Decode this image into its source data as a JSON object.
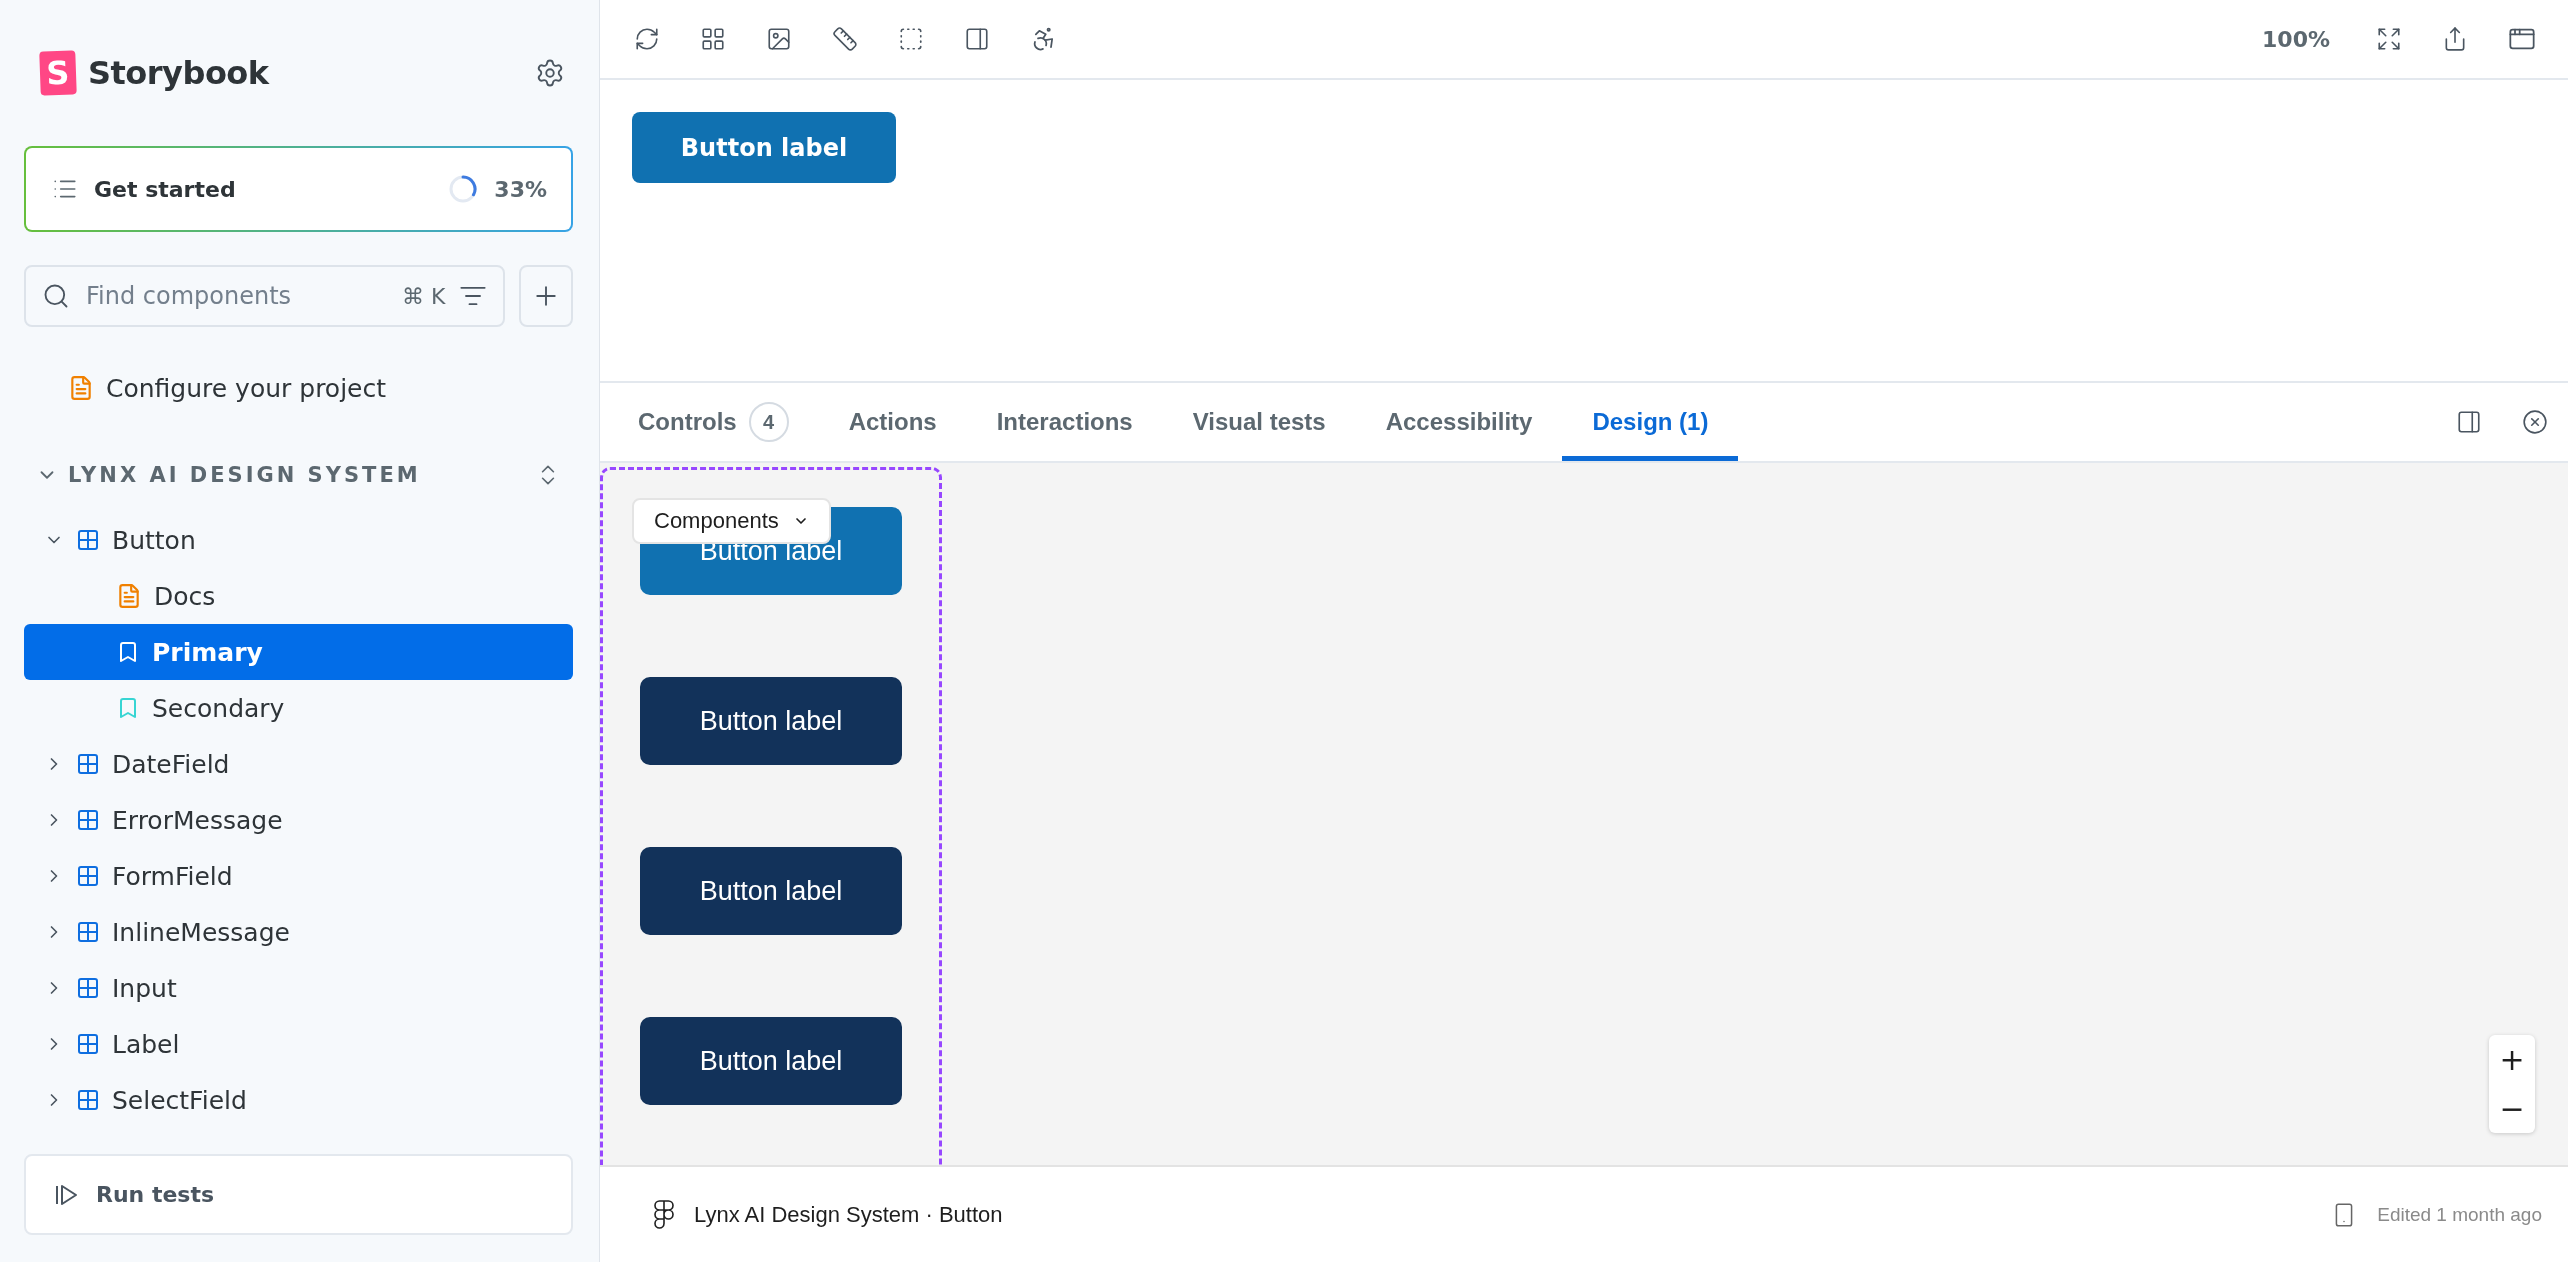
{
  "sidebar": {
    "brand": {
      "letter": "S",
      "name": "Storybook"
    },
    "onboarding": {
      "label": "Get started",
      "progress": "33%",
      "level": 0.33
    },
    "search": {
      "placeholder": "Find components",
      "shortcut": "⌘ K"
    },
    "pinned": [
      {
        "label": "Configure your project",
        "kind": "doc",
        "selected": false
      }
    ],
    "section": {
      "title": "LYNX AI DESIGN SYSTEM",
      "expanded": true
    },
    "tree": [
      {
        "label": "Button",
        "kind": "component",
        "expanded": true,
        "selected": false,
        "children": [
          {
            "label": "Docs",
            "kind": "doc",
            "selected": false
          },
          {
            "label": "Primary",
            "kind": "story",
            "selected": true
          },
          {
            "label": "Secondary",
            "kind": "story",
            "selected": false
          }
        ]
      },
      {
        "label": "DateField",
        "kind": "component",
        "expanded": false,
        "selected": false
      },
      {
        "label": "ErrorMessage",
        "kind": "component",
        "expanded": false,
        "selected": false
      },
      {
        "label": "FormField",
        "kind": "component",
        "expanded": false,
        "selected": false
      },
      {
        "label": "InlineMessage",
        "kind": "component",
        "expanded": false,
        "selected": false
      },
      {
        "label": "Input",
        "kind": "component",
        "expanded": false,
        "selected": false
      },
      {
        "label": "Label",
        "kind": "component",
        "expanded": false,
        "selected": false
      },
      {
        "label": "SelectField",
        "kind": "component",
        "expanded": false,
        "selected": false
      }
    ],
    "run_tests": "Run tests"
  },
  "toolbar": {
    "zoom": "100%"
  },
  "preview": {
    "button": "Button label"
  },
  "addons": {
    "tabs": [
      {
        "label": "Controls",
        "badge": "4",
        "selected": false
      },
      {
        "label": "Actions",
        "selected": false
      },
      {
        "label": "Interactions",
        "selected": false
      },
      {
        "label": "Visual tests",
        "selected": false
      },
      {
        "label": "Accessibility",
        "selected": false
      },
      {
        "label": "Design (1)",
        "selected": true
      }
    ]
  },
  "design": {
    "layer_menu": "Components",
    "buttons": [
      {
        "label": "Button label",
        "kind": "primary"
      },
      {
        "label": "Button label",
        "kind": "dark"
      },
      {
        "label": "Button label",
        "kind": "dark"
      },
      {
        "label": "Button label",
        "kind": "dark"
      }
    ],
    "zoom_in": "+",
    "zoom_out": "−",
    "file": "Lynx AI Design System · Button",
    "edited": "Edited 1 month ago"
  }
}
